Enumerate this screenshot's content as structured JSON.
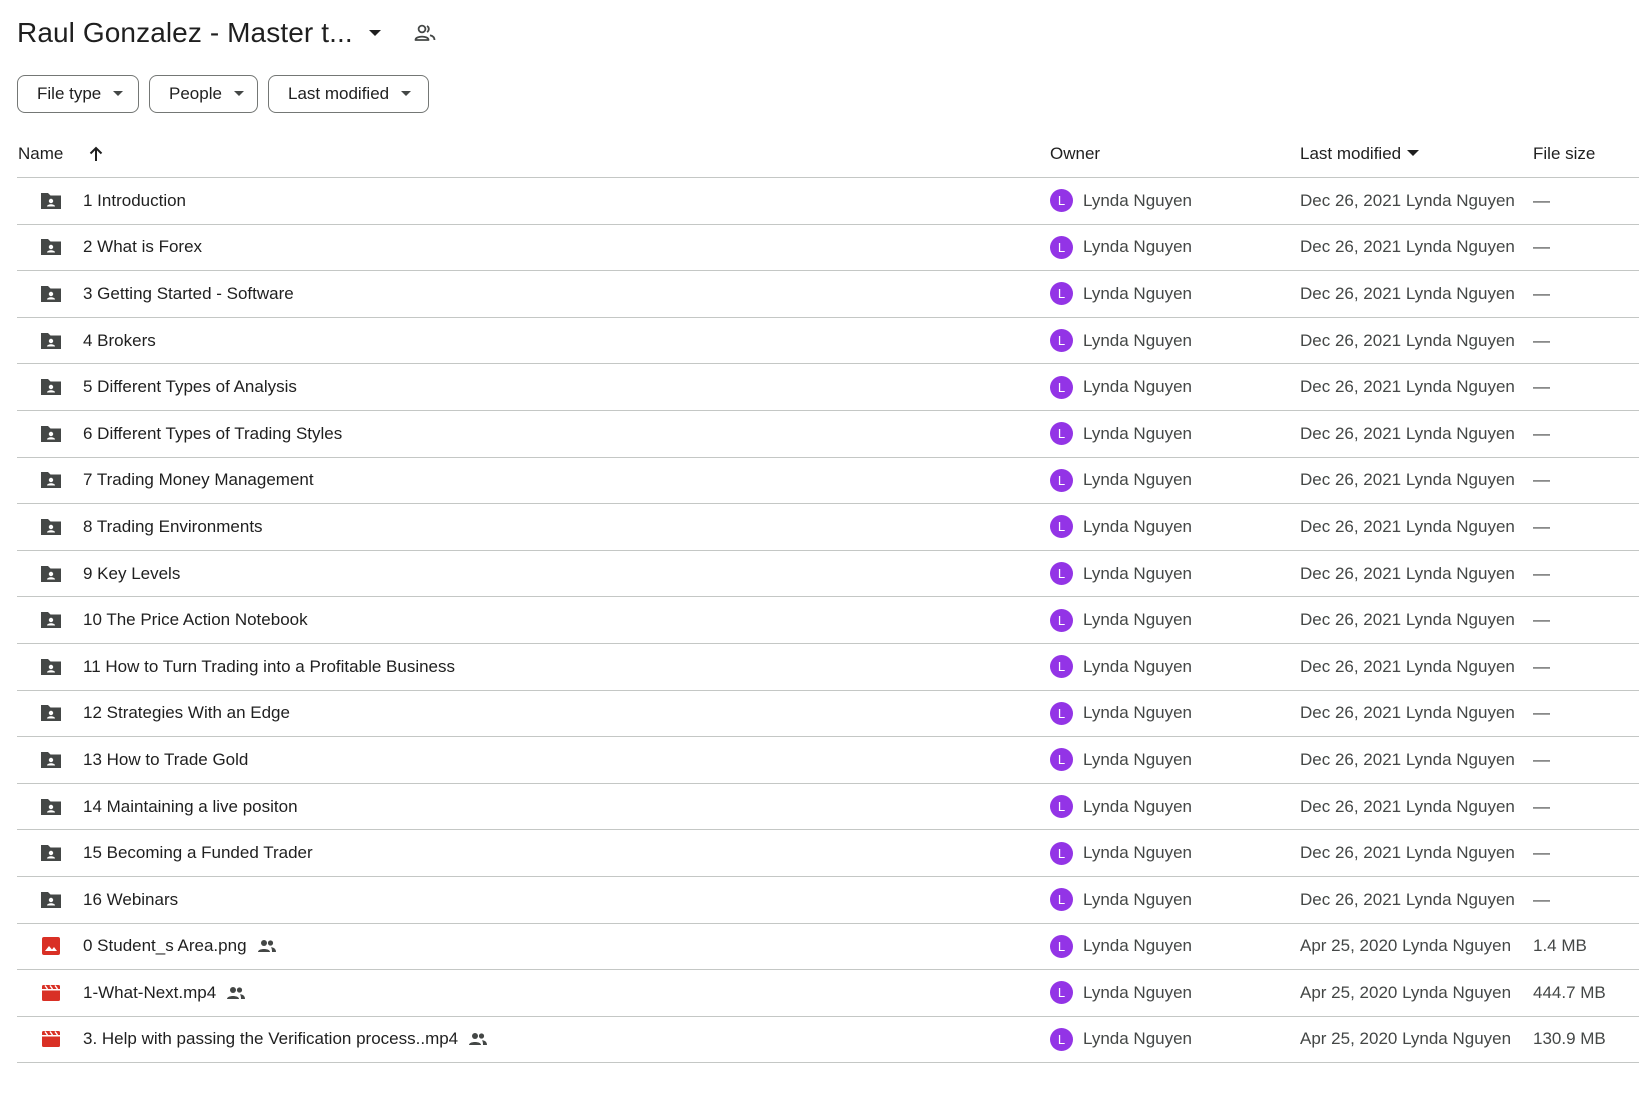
{
  "header": {
    "title": "Raul Gonzalez - Master t...",
    "title_caret_icon": "arrow-drop-down-icon",
    "shared_icon": "people-outline-icon"
  },
  "filters": [
    {
      "label": "File type"
    },
    {
      "label": "People"
    },
    {
      "label": "Last modified"
    }
  ],
  "table": {
    "columns": {
      "name": "Name",
      "owner": "Owner",
      "last_modified": "Last modified",
      "file_size": "File size"
    },
    "sort": {
      "column": "Name",
      "direction": "ascending",
      "icon": "arrow-upward-icon"
    },
    "rows": [
      {
        "type": "shared-folder",
        "name": "1 Introduction",
        "owner_initial": "L",
        "owner": "Lynda Nguyen",
        "modified": "Dec 26, 2021 Lynda Nguyen",
        "size": "—"
      },
      {
        "type": "shared-folder",
        "name": "2 What is Forex",
        "owner_initial": "L",
        "owner": "Lynda Nguyen",
        "modified": "Dec 26, 2021 Lynda Nguyen",
        "size": "—"
      },
      {
        "type": "shared-folder",
        "name": "3 Getting Started - Software",
        "owner_initial": "L",
        "owner": "Lynda Nguyen",
        "modified": "Dec 26, 2021 Lynda Nguyen",
        "size": "—"
      },
      {
        "type": "shared-folder",
        "name": "4 Brokers",
        "owner_initial": "L",
        "owner": "Lynda Nguyen",
        "modified": "Dec 26, 2021 Lynda Nguyen",
        "size": "—"
      },
      {
        "type": "shared-folder",
        "name": "5 Different Types of Analysis",
        "owner_initial": "L",
        "owner": "Lynda Nguyen",
        "modified": "Dec 26, 2021 Lynda Nguyen",
        "size": "—"
      },
      {
        "type": "shared-folder",
        "name": "6 Different Types of Trading Styles",
        "owner_initial": "L",
        "owner": "Lynda Nguyen",
        "modified": "Dec 26, 2021 Lynda Nguyen",
        "size": "—"
      },
      {
        "type": "shared-folder",
        "name": "7 Trading Money Management",
        "owner_initial": "L",
        "owner": "Lynda Nguyen",
        "modified": "Dec 26, 2021 Lynda Nguyen",
        "size": "—"
      },
      {
        "type": "shared-folder",
        "name": "8 Trading Environments",
        "owner_initial": "L",
        "owner": "Lynda Nguyen",
        "modified": "Dec 26, 2021 Lynda Nguyen",
        "size": "—"
      },
      {
        "type": "shared-folder",
        "name": "9 Key Levels",
        "owner_initial": "L",
        "owner": "Lynda Nguyen",
        "modified": "Dec 26, 2021 Lynda Nguyen",
        "size": "—"
      },
      {
        "type": "shared-folder",
        "name": "10 The Price Action Notebook",
        "owner_initial": "L",
        "owner": "Lynda Nguyen",
        "modified": "Dec 26, 2021 Lynda Nguyen",
        "size": "—"
      },
      {
        "type": "shared-folder",
        "name": "11 How to Turn Trading into a Profitable Business",
        "owner_initial": "L",
        "owner": "Lynda Nguyen",
        "modified": "Dec 26, 2021 Lynda Nguyen",
        "size": "—"
      },
      {
        "type": "shared-folder",
        "name": "12 Strategies With an Edge",
        "owner_initial": "L",
        "owner": "Lynda Nguyen",
        "modified": "Dec 26, 2021 Lynda Nguyen",
        "size": "—"
      },
      {
        "type": "shared-folder",
        "name": "13 How to Trade Gold",
        "owner_initial": "L",
        "owner": "Lynda Nguyen",
        "modified": "Dec 26, 2021 Lynda Nguyen",
        "size": "—"
      },
      {
        "type": "shared-folder",
        "name": "14 Maintaining a live positon",
        "owner_initial": "L",
        "owner": "Lynda Nguyen",
        "modified": "Dec 26, 2021 Lynda Nguyen",
        "size": "—"
      },
      {
        "type": "shared-folder",
        "name": "15 Becoming a Funded Trader",
        "owner_initial": "L",
        "owner": "Lynda Nguyen",
        "modified": "Dec 26, 2021 Lynda Nguyen",
        "size": "—"
      },
      {
        "type": "shared-folder",
        "name": "16 Webinars",
        "owner_initial": "L",
        "owner": "Lynda Nguyen",
        "modified": "Dec 26, 2021 Lynda Nguyen",
        "size": "—"
      },
      {
        "type": "image",
        "name": "0 Student_s Area.png",
        "shared": true,
        "owner_initial": "L",
        "owner": "Lynda Nguyen",
        "modified": "Apr 25, 2020 Lynda Nguyen",
        "size": "1.4 MB"
      },
      {
        "type": "video",
        "name": "1-What-Next.mp4",
        "shared": true,
        "owner_initial": "L",
        "owner": "Lynda Nguyen",
        "modified": "Apr 25, 2020 Lynda Nguyen",
        "size": "444.7 MB"
      },
      {
        "type": "video",
        "name": "3. Help with passing the Verification process..mp4",
        "shared": true,
        "owner_initial": "L",
        "owner": "Lynda Nguyen",
        "modified": "Apr 25, 2020 Lynda Nguyen",
        "size": "130.9 MB"
      }
    ]
  },
  "colors": {
    "avatar": "#9334e6",
    "folder_icon": "#444746",
    "file_icon_red": "#d93025",
    "divider": "#c4c7c5"
  }
}
